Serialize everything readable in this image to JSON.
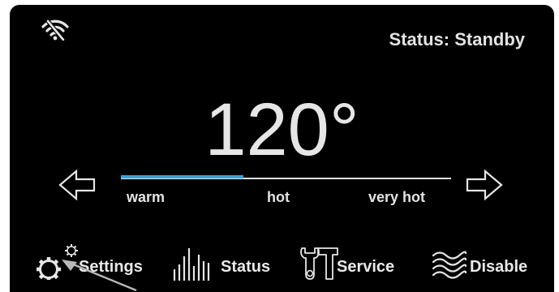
{
  "header": {
    "wifi_icon": "wifi-off-icon",
    "status_text": "Status: Standby"
  },
  "temperature": {
    "value": "120°"
  },
  "slider": {
    "fill_fraction": 0.37,
    "accent_color": "#3aa3da",
    "labels": {
      "warm": "warm",
      "hot": "hot",
      "very_hot": "very hot"
    },
    "left_arrow_icon": "arrow-left-icon",
    "right_arrow_icon": "arrow-right-icon"
  },
  "nav": {
    "settings": {
      "label": "Settings",
      "icon": "gear-icon"
    },
    "status": {
      "label": "Status",
      "icon": "bars-icon"
    },
    "service": {
      "label": "Service",
      "icon": "tools-icon"
    },
    "disable": {
      "label": "Disable",
      "icon": "waves-icon"
    }
  }
}
